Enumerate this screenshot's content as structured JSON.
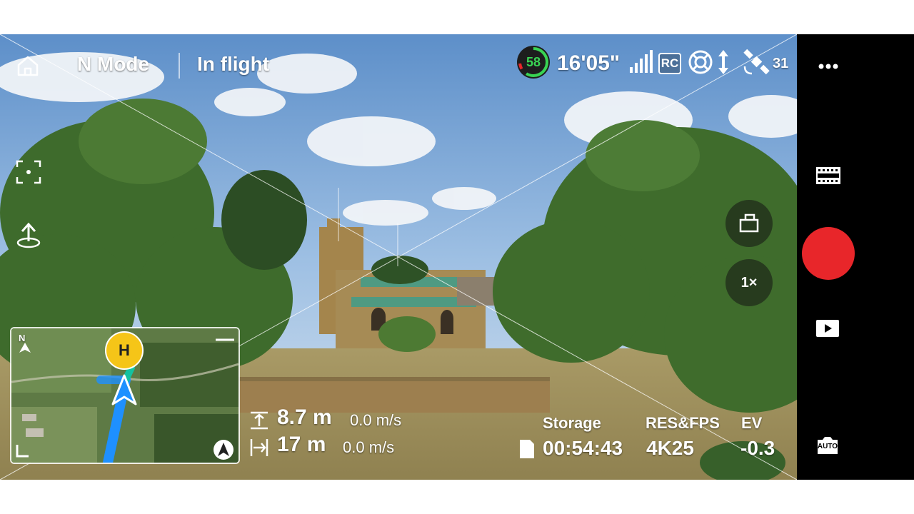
{
  "top_bar": {
    "mode": "N Mode",
    "status": "In flight",
    "battery_percent": "58",
    "flight_time": "16'05\"",
    "rc_label": "RC",
    "satellites": "31"
  },
  "zoom": {
    "label": "1×"
  },
  "telemetry": {
    "height": "8.7 m",
    "vertical_speed": "0.0 m/s",
    "distance": "17 m",
    "horizontal_speed": "0.0 m/s"
  },
  "camera": {
    "storage_label": "Storage",
    "storage_value": "00:54:43",
    "resfps_label": "RES&FPS",
    "resfps_value": "4K25",
    "ev_label": "EV",
    "ev_value": "-0.3",
    "auto_label": "AUTO"
  },
  "map": {
    "north_label": "N",
    "home_label": "H"
  },
  "colors": {
    "record": "#e8262a",
    "battery": "#39d353",
    "home_marker": "#f5c518",
    "flight_path": "#1e90ff"
  }
}
